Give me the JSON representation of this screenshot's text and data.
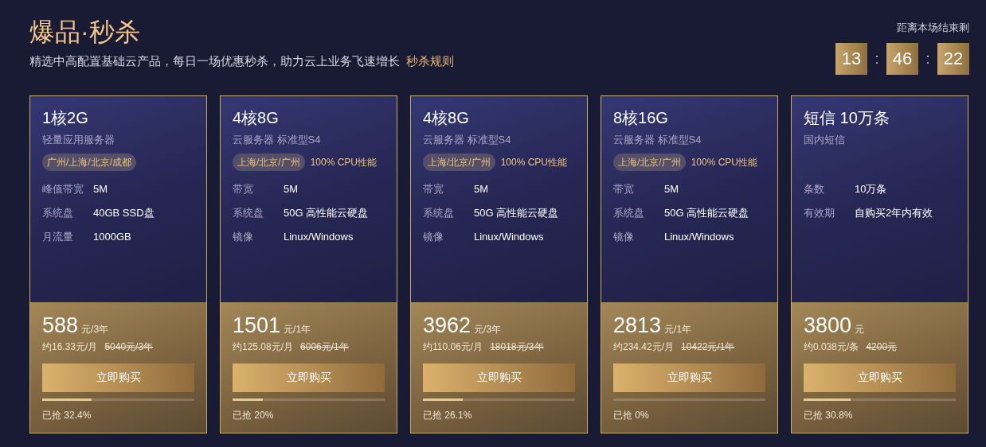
{
  "header": {
    "title": "爆品·秒杀",
    "subtitle": "精选中高配置基础云产品，每日一场优惠秒杀，助力云上业务飞速增长",
    "rules_link": "秒杀规则"
  },
  "countdown": {
    "label": "距离本场结束剩",
    "hours": "13",
    "separator_1": ":",
    "minutes": "46",
    "separator_2": ":",
    "seconds": "22"
  },
  "cards": [
    {
      "title": "1核2G",
      "subtitle": "轻量应用服务器",
      "region": "广州/上海/北京/成都",
      "specs": [
        {
          "label": "峰值带宽",
          "value": "5M"
        },
        {
          "label": "系统盘",
          "value": "40GB SSD盘"
        },
        {
          "label": "月流量",
          "value": "1000GB"
        }
      ],
      "price": "588",
      "unit": "元/3年",
      "monthly": "约16.33元/月",
      "original": "5040元/3年",
      "button": "立即购买",
      "level": 0.324,
      "sold": "已抢 32.4%"
    },
    {
      "title": "4核8G",
      "subtitle": "云服务器 标准型S4",
      "region": "上海/北京/广州",
      "perf": "100% CPU性能",
      "specs": [
        {
          "label": "带宽",
          "value": "5M"
        },
        {
          "label": "系统盘",
          "value": "50G 高性能云硬盘"
        },
        {
          "label": "镜像",
          "value": "Linux/Windows"
        }
      ],
      "price": "1501",
      "unit": "元/1年",
      "monthly": "约125.08元/月",
      "original": "6006元/1年",
      "button": "立即购买",
      "level": 0.2,
      "sold": "已抢 20%"
    },
    {
      "title": "4核8G",
      "subtitle": "云服务器 标准型S4",
      "region": "上海/北京/广州",
      "perf": "100% CPU性能",
      "specs": [
        {
          "label": "带宽",
          "value": "5M"
        },
        {
          "label": "系统盘",
          "value": "50G 高性能云硬盘"
        },
        {
          "label": "镜像",
          "value": "Linux/Windows"
        }
      ],
      "price": "3962",
      "unit": "元/3年",
      "monthly": "约110.06元/月",
      "original": "18018元/3年",
      "button": "立即购买",
      "level": 0.261,
      "sold": "已抢 26.1%"
    },
    {
      "title": "8核16G",
      "subtitle": "云服务器 标准型S4",
      "region": "上海/北京/广州",
      "perf": "100% CPU性能",
      "specs": [
        {
          "label": "带宽",
          "value": "5M"
        },
        {
          "label": "系统盘",
          "value": "50G 高性能云硬盘"
        },
        {
          "label": "镜像",
          "value": "Linux/Windows"
        }
      ],
      "price": "2813",
      "unit": "元/1年",
      "monthly": "约234.42元/月",
      "original": "10422元/1年",
      "button": "立即购买",
      "level": 0,
      "sold": "已抢 0%"
    },
    {
      "title": "短信 10万条",
      "subtitle": "国内短信",
      "specs": [
        {
          "label": "条数",
          "value": "10万条"
        },
        {
          "label": "有效期",
          "value": "自购买2年内有效"
        }
      ],
      "price": "3800",
      "unit": "元",
      "monthly": "约0.038元/条",
      "original": "4200元",
      "button": "立即购买",
      "level": 0.308,
      "sold": "已抢 30.8%"
    }
  ]
}
